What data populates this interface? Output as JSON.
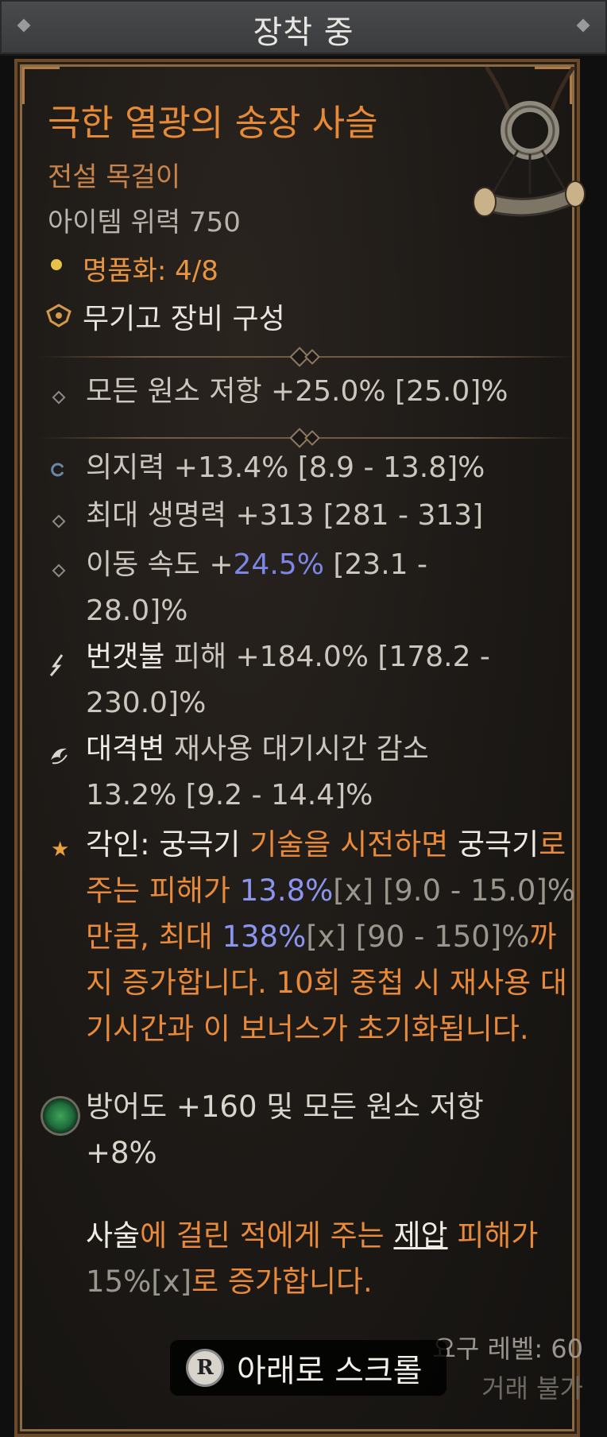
{
  "header": {
    "title": "장착 중"
  },
  "item": {
    "name": "극한 열광의 송장 사슬",
    "type": "전설 목걸이",
    "power": "아이템 위력 750",
    "masterwork": "명품화: 4/8",
    "armory": "무기고 장비 구성"
  },
  "implicit": {
    "line": "모든 원소 저항 +25.0% [25.0]%"
  },
  "affixes": [
    {
      "text": "의지력 +13.4% [8.9 - 13.8]%"
    },
    {
      "text": "최대 생명력 +313 [281 - 313]"
    },
    {
      "label": "이동 속도 +",
      "value": "24.5%",
      "range": " [23.1 -",
      "line2": "28.0]%"
    },
    {
      "skill": "번갯불",
      "rest": " 피해 +184.0% [178.2 -",
      "line2": "230.0]%"
    },
    {
      "skill": "대격변",
      "rest": " 재사용 대기시간 감소",
      "line2": "13.2% [9.2 - 14.4]%"
    }
  ],
  "aspect": {
    "p1": "각인: ",
    "p2": "궁극기",
    "p3": " 기술을 시전하면 ",
    "p4": "궁극기",
    "p5": "로 주는 피해가 ",
    "p6": "13.8%",
    "p7": "[x]",
    "p8": " [9.0 - 15.0]%",
    "p9": "만큼, 최대 ",
    "p10": "138%",
    "p11": "[x]",
    "p12": " [90 - 150]%",
    "p13": "까지 증가합니다. 10회 중첩 시 재사용 대기시간과 이 보너스가 초기화됩니다."
  },
  "gem": {
    "text": "방어도 +160 및 모든 원소 저항 +8%"
  },
  "unique": {
    "u1": "사술",
    "u2": "에 걸린 적에게 주는 ",
    "u3": "제압",
    "u4": " 피해가 ",
    "u5": "15%",
    "u6": "[x]",
    "u7": "로 증가합니다."
  },
  "footer": {
    "required_level": "요구 레벨: 60",
    "trade": "거래 불가",
    "scroll_button": "R",
    "scroll_label": "아래로 스크롤"
  },
  "colors": {
    "legendary": "#e78a38",
    "highlight": "#7d86e6",
    "frame": "#6b4a2c"
  }
}
